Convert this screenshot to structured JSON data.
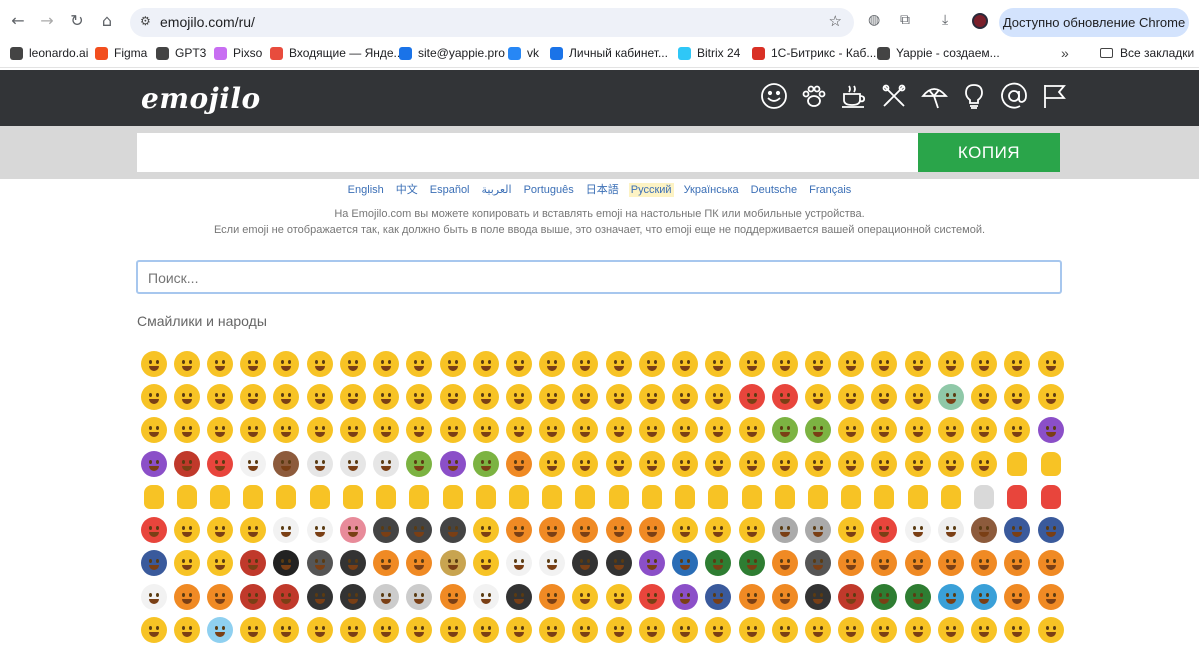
{
  "browser": {
    "url": "emojilo.com/ru/",
    "update_label": "Доступно обновление Chrome",
    "bookmarks": [
      {
        "label": "leonardo.ai",
        "color": "#444444"
      },
      {
        "label": "Figma",
        "color": "#f24e1e"
      },
      {
        "label": "GPT3",
        "color": "#444444"
      },
      {
        "label": "Pixso",
        "color": "#c86ef2"
      },
      {
        "label": "Входящие — Янде...",
        "color": "#e84c3d"
      },
      {
        "label": "site@yappie.pro",
        "color": "#1a73e8"
      },
      {
        "label": "vk",
        "color": "#2787f5"
      },
      {
        "label": "Личный кабинет...",
        "color": "#1a73e8"
      },
      {
        "label": "Bitrix 24",
        "color": "#2fc7f7"
      },
      {
        "label": "1С-Битрикс - Каб...",
        "color": "#d93025"
      },
      {
        "label": "Yappie - создаем...",
        "color": "#444444"
      }
    ],
    "more_label": "»",
    "all_bookmarks_label": "Все закладки"
  },
  "site": {
    "logo": "emojilo",
    "categories": [
      "smileys-icon",
      "animals-icon",
      "food-icon",
      "activity-icon",
      "travel-icon",
      "objects-icon",
      "symbols-icon",
      "flags-icon"
    ],
    "copy_button": "КОПИЯ",
    "languages": [
      "English",
      "中文",
      "Español",
      "العربية",
      "Português",
      "日本語",
      "Русский",
      "Українська",
      "Deutsche",
      "Français"
    ],
    "active_language": "Русский",
    "info_line1": "На Emojilo.com вы можете копировать и вставлять emoji на настольные ПК или мобильные устройства.",
    "info_line2": "Если emoji не отображается так, как должно быть в поле ввода выше, это означает, что emoji еще не поддерживается вашей операционной системой.",
    "search_placeholder": "Поиск...",
    "section_title": "Смайлики и народы"
  },
  "colors": {
    "header_bg": "#323437",
    "copy_button": "#2aa54a",
    "emoji_yellow": "#f7c325"
  },
  "emoji_rows": [
    [
      "#f7c325",
      "#f7c325",
      "#f7c325",
      "#f7c325",
      "#f7c325",
      "#f7c325",
      "#f7c325",
      "#f7c325",
      "#f7c325",
      "#f7c325",
      "#f7c325",
      "#f7c325",
      "#f7c325",
      "#f7c325",
      "#f7c325",
      "#f7c325",
      "#f7c325",
      "#f7c325",
      "#f7c325",
      "#f7c325",
      "#f7c325",
      "#f7c325",
      "#f7c325",
      "#f7c325",
      "#f7c325",
      "#f7c325",
      "#f7c325",
      "#f7c325"
    ],
    [
      "#f7c325",
      "#f7c325",
      "#f7c325",
      "#f7c325",
      "#f7c325",
      "#f7c325",
      "#f7c325",
      "#f7c325",
      "#f7c325",
      "#f7c325",
      "#f7c325",
      "#f7c325",
      "#f7c325",
      "#f7c325",
      "#f7c325",
      "#f7c325",
      "#f7c325",
      "#f7c325",
      "#e8453c",
      "#e8453c",
      "#f7c325",
      "#f7c325",
      "#f7c325",
      "#f7c325",
      "#8fc8a8",
      "#f7c325",
      "#f7c325",
      "#f7c325"
    ],
    [
      "#f7c325",
      "#f7c325",
      "#f7c325",
      "#f7c325",
      "#f7c325",
      "#f7c325",
      "#f7c325",
      "#f7c325",
      "#f7c325",
      "#f7c325",
      "#f7c325",
      "#f7c325",
      "#f7c325",
      "#f7c325",
      "#f7c325",
      "#f7c325",
      "#f7c325",
      "#f7c325",
      "#f7c325",
      "#7cb342",
      "#7cb342",
      "#f7c325",
      "#f7c325",
      "#f7c325",
      "#f7c325",
      "#f7c325",
      "#f7c325",
      "#8b4fc8"
    ],
    [
      "#8b4fc8",
      "#c0392b",
      "#e8453c",
      "#f2f2f2",
      "#8d5b3c",
      "#e6e6e6",
      "#e6e6e6",
      "#e6e6e6",
      "#7cb342",
      "#8b4fc8",
      "#7cb342",
      "#f08a24",
      "#f7c325",
      "#f7c325",
      "#f7c325",
      "#f7c325",
      "#f7c325",
      "#f7c325",
      "#f7c325",
      "#f7c325",
      "#f7c325",
      "#f7c325",
      "#f7c325",
      "#f7c325",
      "#f7c325",
      "#f7c325",
      "#f7c325",
      "#f7c325"
    ],
    [
      "#f7c325",
      "#f7c325",
      "#f7c325",
      "#f7c325",
      "#f7c325",
      "#f7c325",
      "#f7c325",
      "#f7c325",
      "#f7c325",
      "#f7c325",
      "#f7c325",
      "#f7c325",
      "#f7c325",
      "#f7c325",
      "#f7c325",
      "#f7c325",
      "#f7c325",
      "#f7c325",
      "#f7c325",
      "#f7c325",
      "#f7c325",
      "#f7c325",
      "#f7c325",
      "#f7c325",
      "#f7c325",
      "#d9d9d9",
      "#e8453c",
      "#e8453c"
    ],
    [
      "#e8453c",
      "#f7c325",
      "#f7c325",
      "#f7c325",
      "#f2f2f2",
      "#f2f2f2",
      "#e88b9a",
      "#444444",
      "#444444",
      "#444444",
      "#f7c325",
      "#f08a24",
      "#f08a24",
      "#f08a24",
      "#f08a24",
      "#f08a24",
      "#f7c325",
      "#f7c325",
      "#f7c325",
      "#aaaaaa",
      "#aaaaaa",
      "#f7c325",
      "#e8453c",
      "#f2f2f2",
      "#eeeeee",
      "#8d5b3c",
      "#3a5a9c",
      "#3a5a9c"
    ],
    [
      "#3a5a9c",
      "#f7c325",
      "#f7c325",
      "#c0392b",
      "#222222",
      "#555555",
      "#333333",
      "#f08a24",
      "#f08a24",
      "#c8a450",
      "#f7c325",
      "#f2f2f2",
      "#f2f2f2",
      "#333333",
      "#333333",
      "#8b4fc8",
      "#2a6db6",
      "#2e7d32",
      "#2e7d32",
      "#f08a24",
      "#555555",
      "#f08a24",
      "#f08a24",
      "#f08a24",
      "#f08a24",
      "#f08a24",
      "#f08a24",
      "#f08a24"
    ],
    [
      "#f2f2f2",
      "#f08a24",
      "#f08a24",
      "#c0392b",
      "#c0392b",
      "#333333",
      "#333333",
      "#cccccc",
      "#cccccc",
      "#f08a24",
      "#f2f2f2",
      "#333333",
      "#f08a24",
      "#f7c325",
      "#f7c325",
      "#e8453c",
      "#8b4fc8",
      "#3a5a9c",
      "#f08a24",
      "#f08a24",
      "#333333",
      "#c0392b",
      "#2e7d32",
      "#2e7d32",
      "#3aa0d8",
      "#3aa0d8",
      "#f08a24",
      "#f08a24"
    ],
    [
      "#f7c325",
      "#f7c325",
      "#8fd0f0",
      "#f7c325",
      "#f7c325",
      "#f7c325",
      "#f7c325",
      "#f7c325",
      "#f7c325",
      "#f7c325",
      "#f7c325",
      "#f7c325",
      "#f7c325",
      "#f7c325",
      "#f7c325",
      "#f7c325",
      "#f7c325",
      "#f7c325",
      "#f7c325",
      "#f7c325",
      "#f7c325",
      "#f7c325",
      "#f7c325",
      "#f7c325",
      "#f7c325",
      "#f7c325",
      "#f7c325",
      "#f7c325"
    ]
  ]
}
